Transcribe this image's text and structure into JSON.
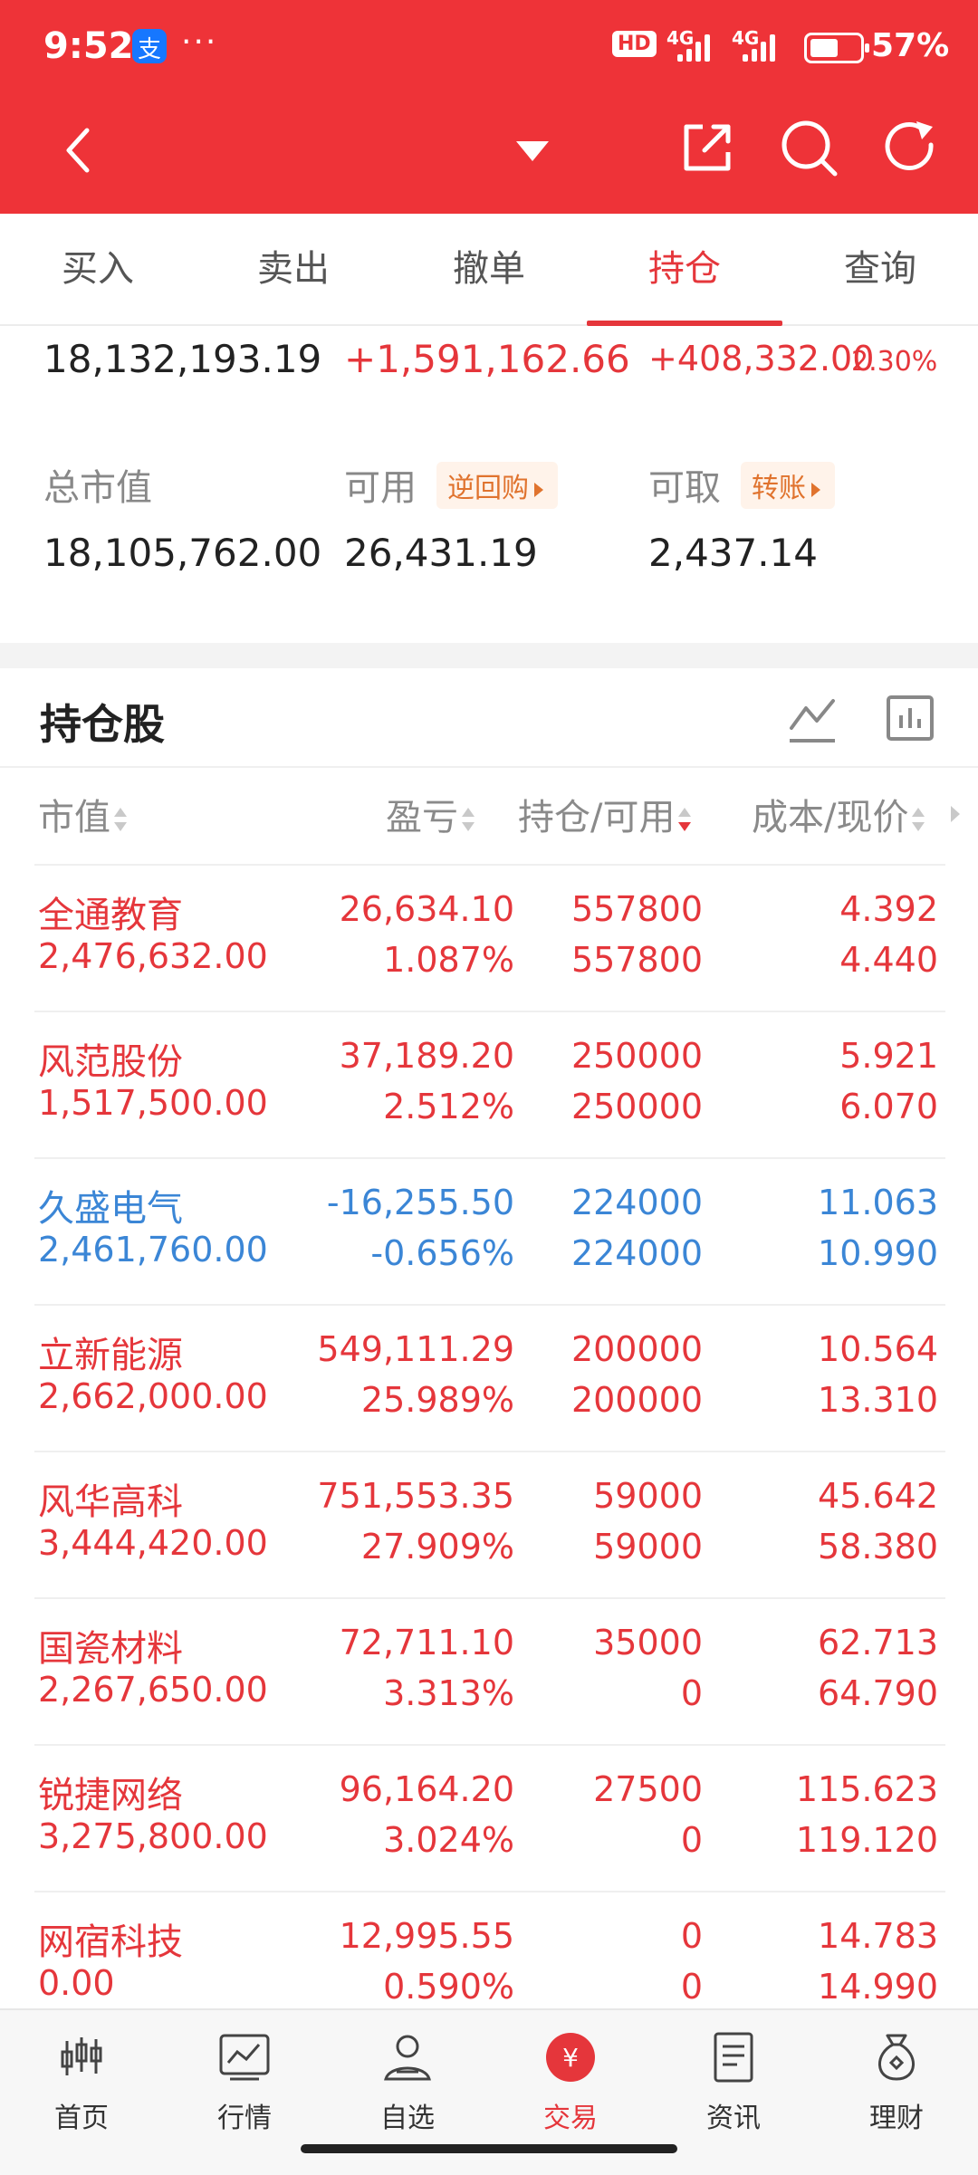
{
  "status_bar": {
    "time": "9:52",
    "more": "···",
    "hd": "HD",
    "net1": "4G",
    "net2": "4G",
    "battery": "57%"
  },
  "nav": {
    "back_icon": "chevron-left-icon",
    "dropdown_icon": "triangle-down-icon",
    "share_icon": "share-icon",
    "search_icon": "search-icon",
    "refresh_icon": "refresh-icon"
  },
  "tabs": [
    {
      "label": "买入"
    },
    {
      "label": "卖出"
    },
    {
      "label": "撤单"
    },
    {
      "label": "持仓",
      "active": true
    },
    {
      "label": "查询"
    }
  ],
  "summary": {
    "row1": {
      "v1": "18,132,193.19",
      "v2": "+1,591,162.66",
      "v3": "+408,332.00",
      "v3pct": "2.30%"
    },
    "total_mv_label": "总市值",
    "total_mv": "18,105,762.00",
    "available_label": "可用",
    "available_pill": "逆回购",
    "available": "26,431.19",
    "withdraw_label": "可取",
    "withdraw_pill": "转账",
    "withdraw": "2,437.14"
  },
  "holdings": {
    "title": "持仓股",
    "headers": {
      "mv": "市值",
      "pnl": "盈亏",
      "pos": "持仓/可用",
      "cost": "成本/现价"
    },
    "rows": [
      {
        "name": "全通教育",
        "mv": "2,476,632.00",
        "pnl": "26,634.10",
        "pnl_pct": "1.087%",
        "pos": "557800",
        "avail": "557800",
        "cost": "4.392",
        "price": "4.440",
        "color": "red"
      },
      {
        "name": "风范股份",
        "mv": "1,517,500.00",
        "pnl": "37,189.20",
        "pnl_pct": "2.512%",
        "pos": "250000",
        "avail": "250000",
        "cost": "5.921",
        "price": "6.070",
        "color": "red"
      },
      {
        "name": "久盛电气",
        "mv": "2,461,760.00",
        "pnl": "-16,255.50",
        "pnl_pct": "-0.656%",
        "pos": "224000",
        "avail": "224000",
        "cost": "11.063",
        "price": "10.990",
        "color": "blue"
      },
      {
        "name": "立新能源",
        "mv": "2,662,000.00",
        "pnl": "549,111.29",
        "pnl_pct": "25.989%",
        "pos": "200000",
        "avail": "200000",
        "cost": "10.564",
        "price": "13.310",
        "color": "red"
      },
      {
        "name": "风华高科",
        "mv": "3,444,420.00",
        "pnl": "751,553.35",
        "pnl_pct": "27.909%",
        "pos": "59000",
        "avail": "59000",
        "cost": "45.642",
        "price": "58.380",
        "color": "red"
      },
      {
        "name": "国瓷材料",
        "mv": "2,267,650.00",
        "pnl": "72,711.10",
        "pnl_pct": "3.313%",
        "pos": "35000",
        "avail": "0",
        "cost": "62.713",
        "price": "64.790",
        "color": "red"
      },
      {
        "name": "锐捷网络",
        "mv": "3,275,800.00",
        "pnl": "96,164.20",
        "pnl_pct": "3.024%",
        "pos": "27500",
        "avail": "0",
        "cost": "115.623",
        "price": "119.120",
        "color": "red"
      },
      {
        "name": "网宿科技",
        "mv": "0.00",
        "pnl": "12,995.55",
        "pnl_pct": "0.590%",
        "pos": "0",
        "avail": "0",
        "cost": "14.783",
        "price": "14.990",
        "color": "red"
      }
    ]
  },
  "bottom_nav": [
    {
      "label": "首页",
      "icon": "home-chart-icon"
    },
    {
      "label": "行情",
      "icon": "market-icon"
    },
    {
      "label": "自选",
      "icon": "watchlist-icon"
    },
    {
      "label": "交易",
      "icon": "trade-icon",
      "active": true
    },
    {
      "label": "资讯",
      "icon": "news-icon"
    },
    {
      "label": "理财",
      "icon": "wealth-icon"
    }
  ],
  "colors": {
    "header_red": "#ee3338",
    "gain_red": "#e5363b",
    "loss_blue": "#3b86d6",
    "pill_orange": "#e0732e"
  }
}
